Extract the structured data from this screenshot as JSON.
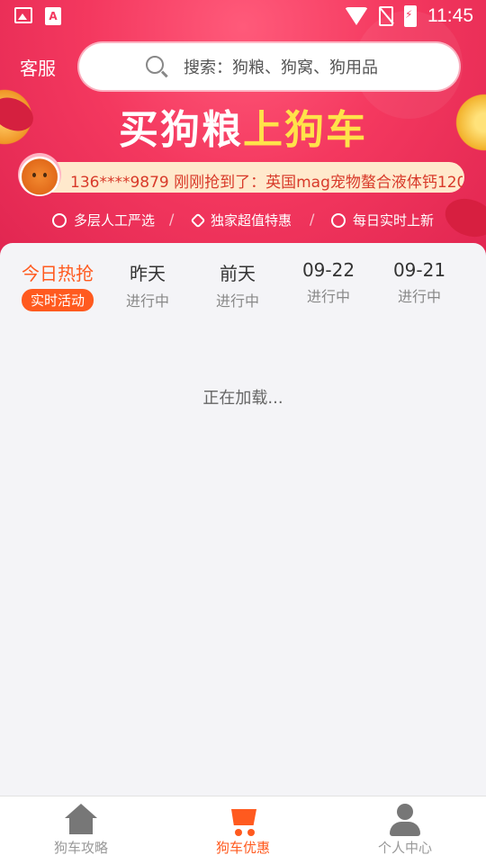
{
  "status_bar": {
    "time": "11:45"
  },
  "header": {
    "service_label": "客服",
    "search_placeholder": "搜索：狗粮、狗窝、狗用品"
  },
  "banner": {
    "headline_white": "买狗粮",
    "headline_yellow": "上狗车",
    "ticker": "136****9879 刚刚抢到了：英国mag宠物螯合液体钙120",
    "features": [
      "多层人工严选",
      "独家超值特惠",
      "每日实时上新"
    ]
  },
  "tabs": [
    {
      "title": "今日热抢",
      "sub": "实时活动"
    },
    {
      "title": "昨天",
      "sub": "进行中"
    },
    {
      "title": "前天",
      "sub": "进行中"
    },
    {
      "title": "09-22",
      "sub": "进行中"
    },
    {
      "title": "09-21",
      "sub": "进行中"
    }
  ],
  "loading_text": "正在加载...",
  "bottom_nav": [
    {
      "label": "狗车攻略",
      "icon": "home-icon"
    },
    {
      "label": "狗车优惠",
      "icon": "cart-icon"
    },
    {
      "label": "个人中心",
      "icon": "user-icon"
    }
  ],
  "colors": {
    "accent": "#ff5a1f",
    "hero": "#f4385f",
    "headline_yellow": "#ffe24a"
  }
}
